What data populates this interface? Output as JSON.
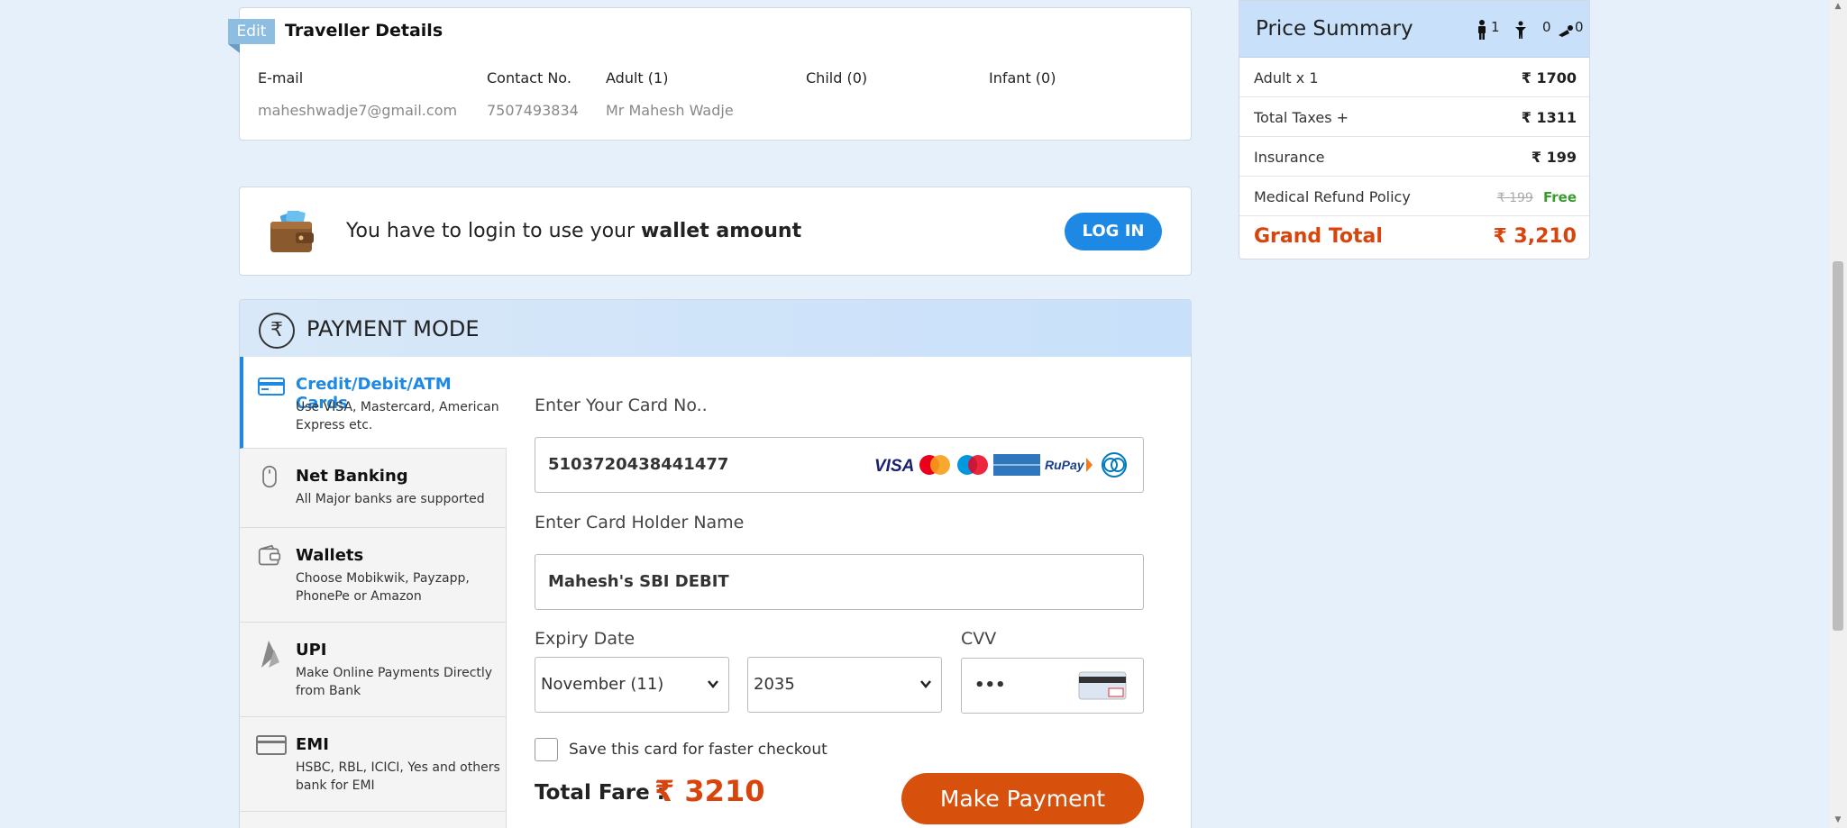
{
  "traveller": {
    "edit_label": "Edit",
    "title": "Traveller Details",
    "columns": [
      {
        "label": "E-mail",
        "value": "maheshwadje7@gmail.com"
      },
      {
        "label": "Contact No.",
        "value": "7507493834"
      },
      {
        "label": "Adult (1)",
        "value": "Mr Mahesh Wadje"
      },
      {
        "label": "Child (0)",
        "value": ""
      },
      {
        "label": "Infant (0)",
        "value": ""
      }
    ]
  },
  "wallet": {
    "text_prefix": "You have to login to use your ",
    "text_bold": "wallet amount",
    "login_label": "LOG IN"
  },
  "payment": {
    "rupee_symbol": "₹",
    "title": "PAYMENT MODE",
    "methods": [
      {
        "title": "Credit/Debit/ATM Cards",
        "subtitle": "Use VISA, Mastercard, American Express etc.",
        "icon": "credit-card-icon"
      },
      {
        "title": "Net Banking",
        "subtitle": "All Major banks are supported",
        "icon": "mouse-icon"
      },
      {
        "title": "Wallets",
        "subtitle": "Choose Mobikwik, Payzapp, PhonePe or Amazon",
        "icon": "wallet-icon"
      },
      {
        "title": "UPI",
        "subtitle": "Make Online Payments Directly from Bank",
        "icon": "upi-icon"
      },
      {
        "title": "EMI",
        "subtitle": "HSBC, RBL, ICICI, Yes and others bank for EMI",
        "icon": "emi-card-icon"
      }
    ],
    "card_no_label": "Enter Your Card No..",
    "card_no_value": "5103720438441477",
    "card_logos": [
      "VISA",
      "MasterCard",
      "Maestro",
      "AMERICAN EXPRESS",
      "RuPay",
      "Diners"
    ],
    "holder_label": "Enter Card Holder Name",
    "holder_value": "Mahesh's SBI DEBIT",
    "expiry_label": "Expiry Date",
    "expiry_month": "November (11)",
    "expiry_year": "2035",
    "cvv_label": "CVV",
    "cvv_value": "•••",
    "save_card_label": "Save this card for faster checkout",
    "total_label": "Total Fare :",
    "total_amount": "₹ 3210",
    "pay_button": "Make Payment"
  },
  "summary": {
    "title": "Price Summary",
    "adults": "1",
    "children": "0",
    "infants": "0",
    "rows": [
      {
        "label": "Adult x 1",
        "value": "₹ 1700"
      },
      {
        "label": "Total Taxes +",
        "value": "₹ 1311"
      },
      {
        "label": "Insurance",
        "value": "₹ 199"
      },
      {
        "label": "Medical Refund Policy",
        "old_value": "₹ 199",
        "value": "Free"
      }
    ],
    "grand_label": "Grand Total",
    "grand_value": "₹ 3,210"
  },
  "colors": {
    "accent": "#1e88e5",
    "brand_orange": "#d8510c",
    "free_green": "#3a9b2e"
  }
}
